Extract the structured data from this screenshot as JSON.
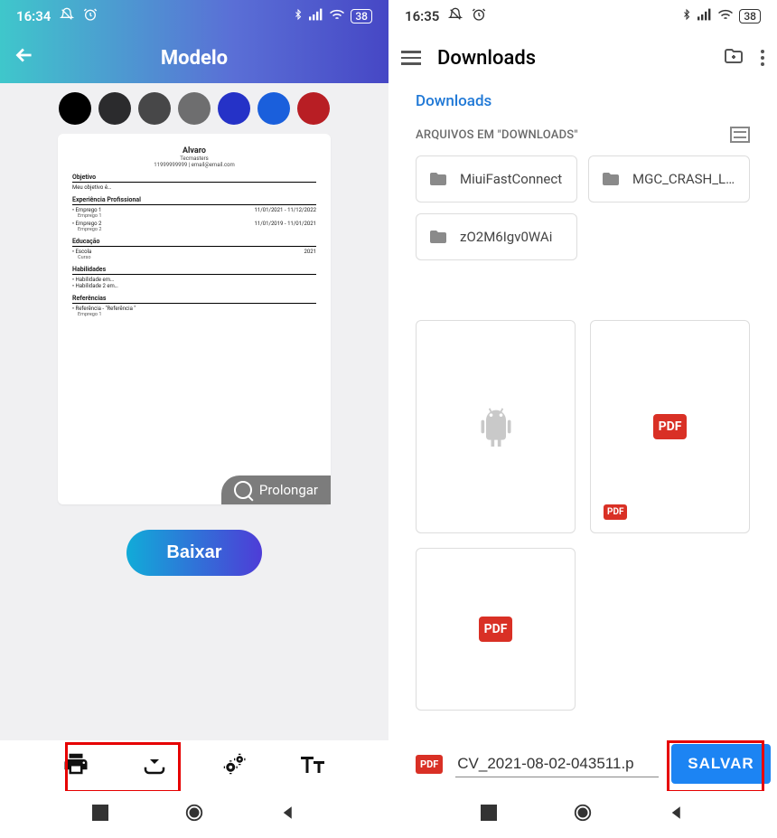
{
  "left": {
    "status": {
      "time": "16:34",
      "battery": "38"
    },
    "header": {
      "title": "Modelo"
    },
    "colors": [
      "#000000",
      "#2b2b2d",
      "#474748",
      "#6e6e6f",
      "#2532c7",
      "#1a5fdc",
      "#b81e24"
    ],
    "preview": {
      "name": "Alvaro",
      "subtitle": "Tecmasters",
      "contact": "11999999999 | email@email.com",
      "sections": {
        "objetivo_h": "Objetivo",
        "objetivo_txt": "Meu objetivo é…",
        "exp_h": "Experiência Profissional",
        "exp1": "Emprego 1",
        "exp1_sub": "Emprego 1",
        "exp1_dates": "11/01/2021 - 11/12/2022",
        "exp2": "Emprego 2",
        "exp2_sub": "Emprego 2",
        "exp2_dates": "11/01/2019 - 11/01/2021",
        "edu_h": "Educação",
        "edu1": "Escola",
        "edu1_sub": "Curso",
        "edu1_year": "2021",
        "hab_h": "Habilidades",
        "hab1": "Habilidade em…",
        "hab2": "Habilidade 2 em…",
        "ref_h": "Referências",
        "ref1": "Referência - \"Referência \"",
        "ref1_sub": "Emprego 1"
      }
    },
    "prolongar": "Prolongar",
    "baixar": "Baixar"
  },
  "right": {
    "status": {
      "time": "16:35",
      "battery": "38"
    },
    "header": {
      "title": "Downloads"
    },
    "breadcrumb": "Downloads",
    "section_label": "ARQUIVOS EM \"DOWNLOADS\"",
    "folders": [
      {
        "name": "MiuiFastConnect"
      },
      {
        "name": "MGC_CRASH_L…"
      },
      {
        "name": "zO2M6Igv0WAi"
      }
    ],
    "badges": {
      "pdf": "PDF"
    },
    "filename": "CV_2021-08-02-043511.p",
    "save": "SALVAR"
  }
}
